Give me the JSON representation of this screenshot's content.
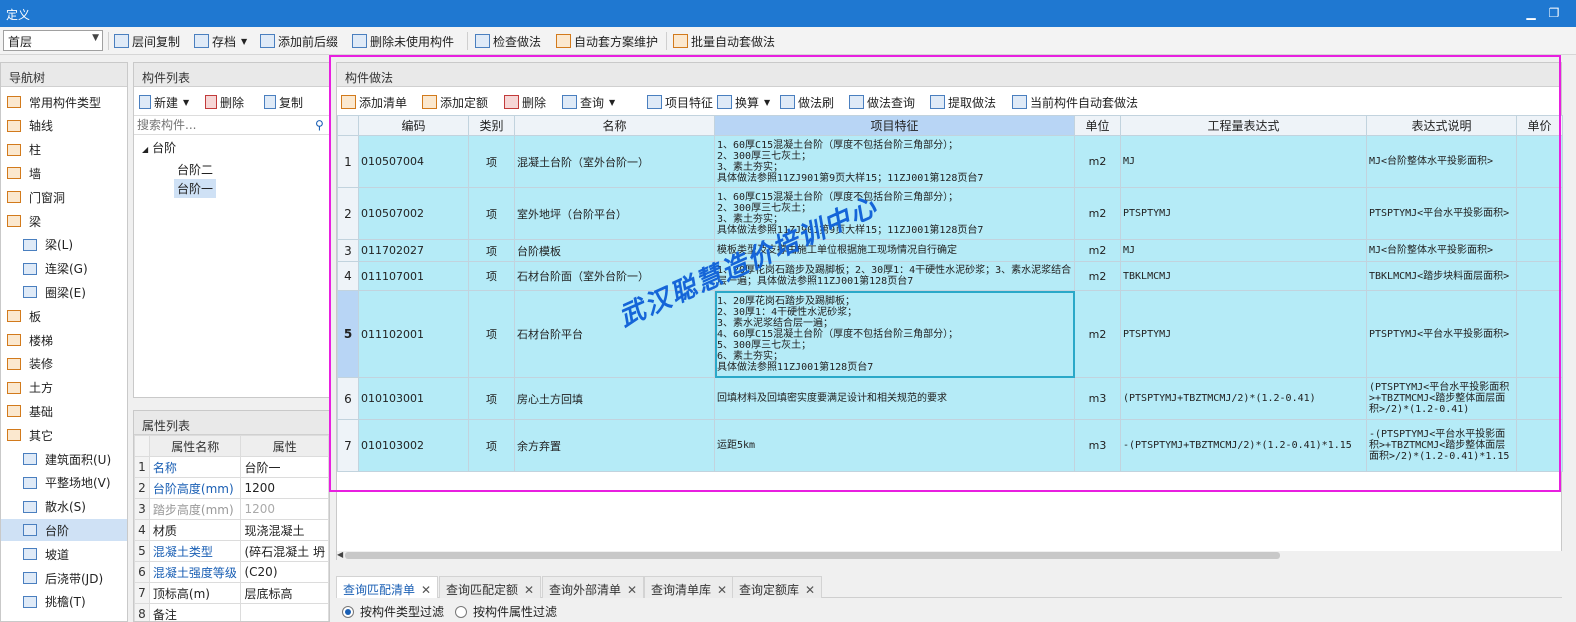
{
  "window": {
    "title": "定义"
  },
  "toolbar": {
    "floor": "首层",
    "buttons": [
      "层间复制",
      "存档",
      "添加前后缀",
      "删除未使用构件",
      "检查做法",
      "自动套方案维护",
      "批量自动套做法"
    ]
  },
  "nav": {
    "title": "导航树",
    "items": [
      {
        "label": "常用构件类型",
        "level": "top"
      },
      {
        "label": "轴线",
        "level": "top"
      },
      {
        "label": "柱",
        "level": "top"
      },
      {
        "label": "墙",
        "level": "top"
      },
      {
        "label": "门窗洞",
        "level": "top"
      },
      {
        "label": "梁",
        "level": "top"
      },
      {
        "label": "梁(L)",
        "level": "sub"
      },
      {
        "label": "连梁(G)",
        "level": "sub"
      },
      {
        "label": "圈梁(E)",
        "level": "sub"
      },
      {
        "label": "板",
        "level": "top"
      },
      {
        "label": "楼梯",
        "level": "top"
      },
      {
        "label": "装修",
        "level": "top"
      },
      {
        "label": "土方",
        "level": "top"
      },
      {
        "label": "基础",
        "level": "top"
      },
      {
        "label": "其它",
        "level": "top"
      },
      {
        "label": "建筑面积(U)",
        "level": "sub"
      },
      {
        "label": "平整场地(V)",
        "level": "sub"
      },
      {
        "label": "散水(S)",
        "level": "sub"
      },
      {
        "label": "台阶",
        "level": "sub"
      },
      {
        "label": "坡道",
        "level": "sub"
      },
      {
        "label": "后浇带(JD)",
        "level": "sub"
      },
      {
        "label": "挑檐(T)",
        "level": "sub"
      }
    ]
  },
  "component_list": {
    "title": "构件列表",
    "new_label": "新建",
    "delete_label": "删除",
    "copy_label": "复制",
    "search_placeholder": "搜索构件...",
    "tree_root": "台阶",
    "tree_children": [
      "台阶二",
      "台阶一"
    ]
  },
  "props": {
    "title": "属性列表",
    "header_name": "属性名称",
    "header_value": "属性",
    "rows": [
      {
        "n": "1",
        "name": "名称",
        "value": "台阶一"
      },
      {
        "n": "2",
        "name": "台阶高度(mm)",
        "value": "1200"
      },
      {
        "n": "3",
        "name": "踏步高度(mm)",
        "value": "1200"
      },
      {
        "n": "4",
        "name": "材质",
        "value": "现浇混凝土"
      },
      {
        "n": "5",
        "name": "混凝土类型",
        "value": "(碎石混凝土 坍"
      },
      {
        "n": "6",
        "name": "混凝土强度等级",
        "value": "(C20)"
      },
      {
        "n": "7",
        "name": "顶标高(m)",
        "value": "层底标高"
      },
      {
        "n": "8",
        "name": "备注",
        "value": ""
      }
    ]
  },
  "method": {
    "title": "构件做法",
    "toolbar": [
      "添加清单",
      "添加定额",
      "删除",
      "查询",
      "项目特征",
      "换算",
      "做法刷",
      "做法查询",
      "提取做法",
      "当前构件自动套做法"
    ],
    "headers": [
      "编码",
      "类别",
      "名称",
      "项目特征",
      "单位",
      "工程量表达式",
      "表达式说明",
      "单价"
    ],
    "rows": [
      {
        "n": "1",
        "code": "010507004",
        "type": "项",
        "name": "混凝土台阶（室外台阶一）",
        "feature": "1、60厚C15混凝土台阶（厚度不包括台阶三角部分）；\n2、300厚三七灰土；\n3、素土夯实；\n具体做法参照11ZJ901第9页大样15；11ZJ001第128页台7",
        "unit": "m2",
        "expr": "MJ",
        "desc": "MJ<台阶整体水平投影面积>"
      },
      {
        "n": "2",
        "code": "010507002",
        "type": "项",
        "name": "室外地坪（台阶平台）",
        "feature": "1、60厚C15混凝土台阶（厚度不包括台阶三角部分）；\n2、300厚三七灰土；\n3、素土夯实；\n具体做法参照11ZJ901第9页大样15；11ZJ001第128页台7",
        "unit": "m2",
        "expr": "PTSPTYMJ",
        "desc": "PTSPTYMJ<平台水平投影面积>"
      },
      {
        "n": "3",
        "code": "011702027",
        "type": "项",
        "name": "台阶模板",
        "feature": "模板类型及支撑由施工单位根据施工现场情况自行确定",
        "unit": "m2",
        "expr": "MJ",
        "desc": "MJ<台阶整体水平投影面积>"
      },
      {
        "n": "4",
        "code": "011107001",
        "type": "项",
        "name": "石材台阶面（室外台阶一）",
        "feature": "1、20厚花岗石踏步及踢脚板；2、30厚1：4干硬性水泥砂浆；3、素水泥浆结合层一遍；具体做法参照11ZJ001第128页台7",
        "unit": "m2",
        "expr": "TBKLMCMJ",
        "desc": "TBKLMCMJ<踏步块料面层面积>"
      },
      {
        "n": "5",
        "code": "011102001",
        "type": "项",
        "name": "石材台阶平台",
        "feature": "1、20厚花岗石踏步及踢脚板；\n2、30厚1：4干硬性水泥砂浆；\n3、素水泥浆结合层一遍；\n4、60厚C15混凝土台阶（厚度不包括台阶三角部分）；\n5、300厚三七灰土；\n6、素土夯实；\n具体做法参照11ZJ001第128页台7",
        "unit": "m2",
        "expr": "PTSPTYMJ",
        "desc": "PTSPTYMJ<平台水平投影面积>"
      },
      {
        "n": "6",
        "code": "010103001",
        "type": "项",
        "name": "房心土方回填",
        "feature": "回填材料及回填密实度要满足设计和相关规范的要求",
        "unit": "m3",
        "expr": "(PTSPTYMJ+TBZTMCMJ/2)*(1.2-0.41)",
        "desc": "(PTSPTYMJ<平台水平投影面积>+TBZTMCMJ<踏步整体面层面积>/2)*(1.2-0.41)"
      },
      {
        "n": "7",
        "code": "010103002",
        "type": "项",
        "name": "余方弃置",
        "feature": "运距5km",
        "unit": "m3",
        "expr": "-(PTSPTYMJ+TBZTMCMJ/2)*(1.2-0.41)*1.15",
        "desc": "-(PTSPTYMJ<平台水平投影面积>+TBZTMCMJ<踏步整体面层面积>/2)*(1.2-0.41)*1.15"
      }
    ]
  },
  "bottom_tabs": [
    "查询匹配清单",
    "查询匹配定额",
    "查询外部清单",
    "查询清单库",
    "查询定额库"
  ],
  "filters": [
    "按构件类型过滤",
    "按构件属性过滤"
  ],
  "watermark": "武汉聪慧造价培训中心"
}
